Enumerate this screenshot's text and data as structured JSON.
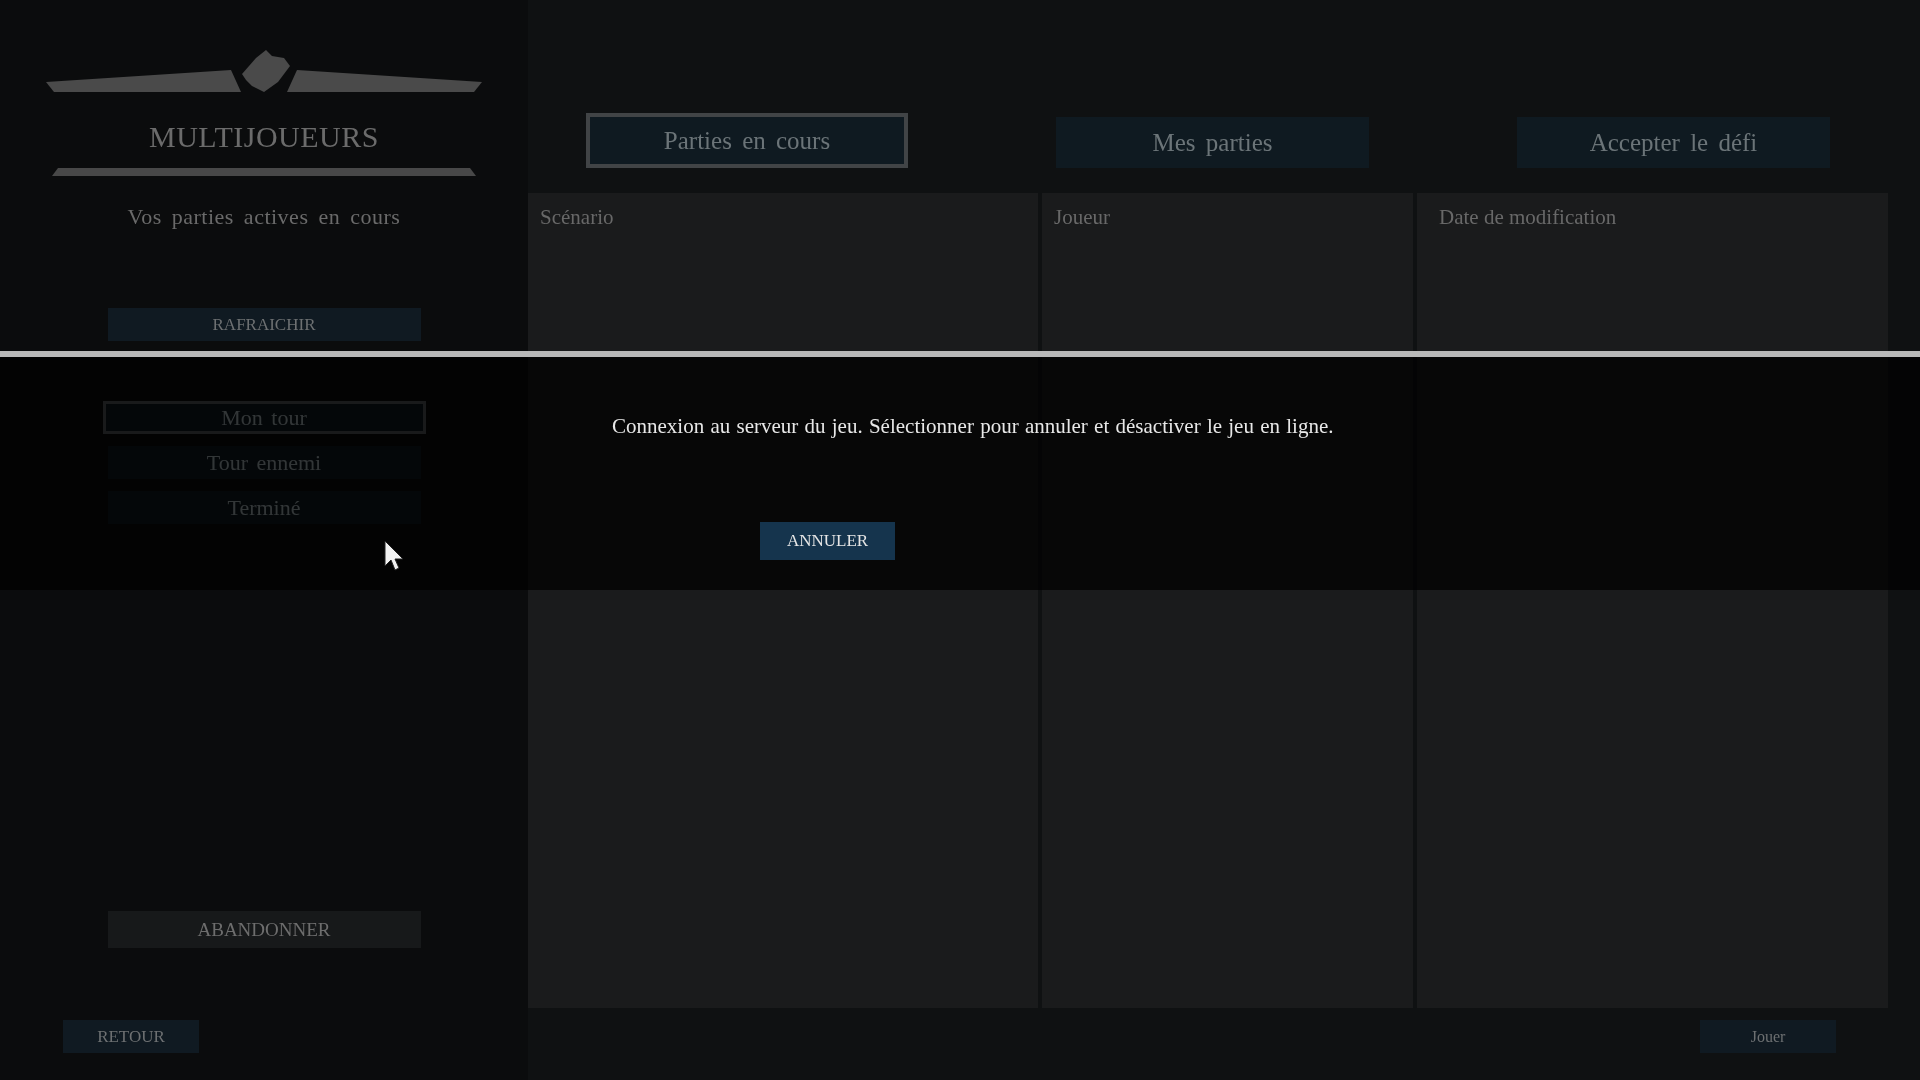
{
  "sidebar": {
    "title": "MULTIJOUEURS",
    "subtitle": "Vos parties actives en cours",
    "refresh_button": "RAFRAICHIR",
    "filters": [
      {
        "label": "Mon tour",
        "selected": true
      },
      {
        "label": "Tour ennemi",
        "selected": false
      },
      {
        "label": "Terminé",
        "selected": false
      }
    ],
    "abandon_button": "ABANDONNER",
    "back_button": "RETOUR"
  },
  "tabs": [
    {
      "label": "Parties en cours",
      "selected": true
    },
    {
      "label": "Mes parties",
      "selected": false
    },
    {
      "label": "Accepter le défi",
      "selected": false
    }
  ],
  "table": {
    "columns": [
      "Scénario",
      "Joueur",
      "Date de modification"
    ]
  },
  "play_button": "Jouer",
  "dialog": {
    "message": "Connexion au serveur du jeu. Sélectionner pour annuler et désactiver le jeu en ligne.",
    "cancel_button": "ANNULER"
  }
}
